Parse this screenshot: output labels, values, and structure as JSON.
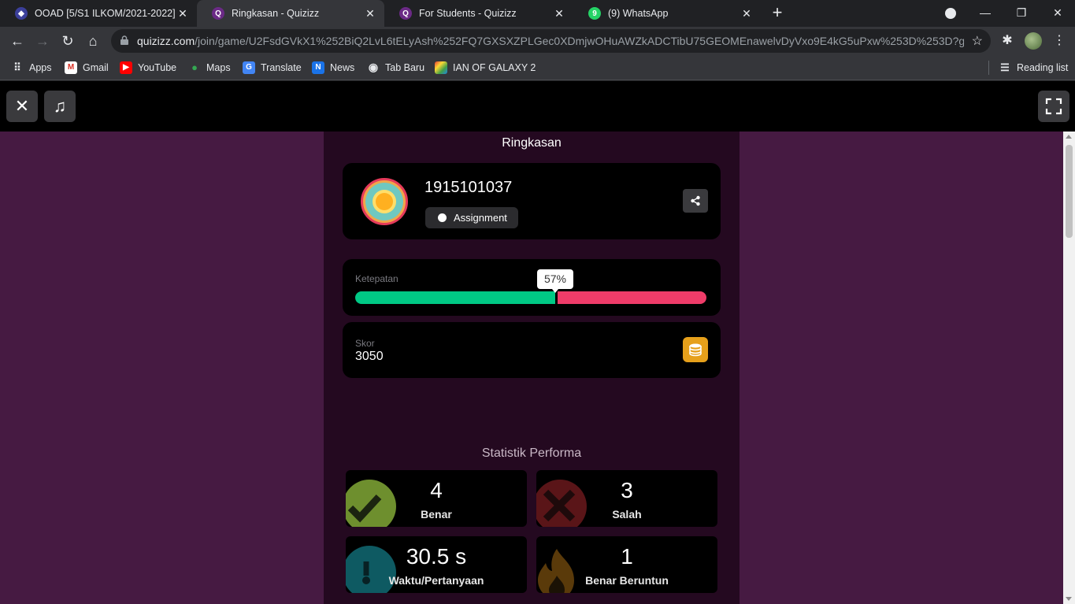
{
  "browser": {
    "tabs": [
      {
        "title": "OOAD [5/S1 ILKOM/2021-2022]:",
        "icon": "campus-crest-icon",
        "active": false
      },
      {
        "title": "Ringkasan - Quizizz",
        "icon": "quizizz-icon",
        "active": true
      },
      {
        "title": "For Students - Quizizz",
        "icon": "quizizz-icon",
        "active": false
      },
      {
        "title": "(9) WhatsApp",
        "icon": "whatsapp-icon",
        "active": false
      }
    ],
    "url_host": "quizizz.com",
    "url_rest": "/join/game/U2FsdGVkX1%252BiQ2LvL6tELyAsh%252FQ7GXSXZPLGec0XDmjwOHuAWZkADCTibU75GEOMEnawelvDyVxo9E4kG5uPxw%253D%253D?gameT...",
    "bookmarks": [
      "Apps",
      "Gmail",
      "YouTube",
      "Maps",
      "Translate",
      "News",
      "Tab Baru",
      "IAN OF GALAXY 2"
    ],
    "reading_list": "Reading list",
    "whatsapp_badge": "9"
  },
  "summary": {
    "title": "Ringkasan",
    "username": "1915101037",
    "mode": "Assignment",
    "accuracy_label": "Ketepatan",
    "accuracy_value": "57%",
    "accuracy_fraction": 0.57,
    "score_label": "Skor",
    "score_value": "3050"
  },
  "performance": {
    "title": "Statistik Performa",
    "stats": [
      {
        "value": "4",
        "label": "Benar"
      },
      {
        "value": "3",
        "label": "Salah"
      },
      {
        "value": "30.5 s",
        "label": "Waktu/Pertanyaan"
      },
      {
        "value": "1",
        "label": "Benar Beruntun"
      }
    ]
  },
  "colors": {
    "page_bg": "#461a42",
    "column_bg": "#240920",
    "correct": "#00c985",
    "incorrect": "#ef3c69",
    "coin": "#e6a01b"
  }
}
